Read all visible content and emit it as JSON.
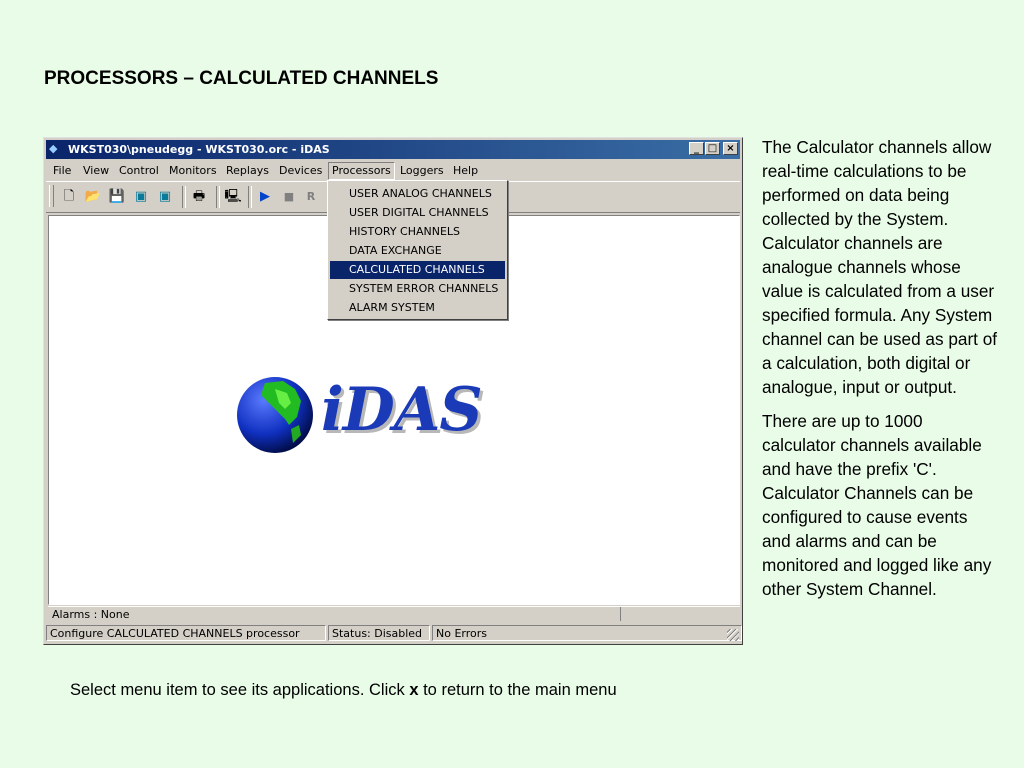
{
  "slide": {
    "title": "PROCESSORS – CALCULATED CHANNELS",
    "description_paragraphs": [
      "The Calculator channels allow real-time calculations to be performed on data being collected by the System. Calculator channels are analogue channels whose value is calculated from a user specified formula. Any System channel can be used as part of a calculation, both digital or analogue, input or output.",
      "There are up to 1000 calculator channels available and have the prefix 'C'.  Calculator Channels can be configured to cause events and alarms and can be monitored and logged like any other System Channel."
    ],
    "caption_before": "Select menu item to see its applications. Click ",
    "caption_key": "x",
    "caption_after": " to return to the main menu"
  },
  "window": {
    "title": "WKST030\\pneudegg - WKST030.orc - iDAS",
    "caption_buttons": {
      "minimize": "_",
      "maximize": "□",
      "close": "×"
    },
    "menu": [
      "File",
      "View",
      "Control",
      "Monitors",
      "Replays",
      "Devices",
      "Processors",
      "Loggers",
      "Help"
    ],
    "open_menu": "Processors",
    "dropdown_items": [
      "USER ANALOG CHANNELS",
      "USER DIGITAL CHANNELS",
      "HISTORY CHANNELS",
      "DATA EXCHANGE",
      "CALCULATED CHANNELS",
      "SYSTEM ERROR CHANNELS",
      "ALARM SYSTEM"
    ],
    "selected_dropdown_item": "CALCULATED CHANNELS",
    "toolbar_icons": [
      "new-file-icon",
      "open-folder-icon",
      "save-icon",
      "monitor-add-icon",
      "monitor-edit-icon",
      "print-icon",
      "computer-icon",
      "play-icon",
      "stop-icon",
      "replay-icon"
    ],
    "logo_text": "iDAS",
    "alarms_label": "Alarms :  None",
    "status_panels": [
      "Configure CALCULATED CHANNELS processor",
      "Status: Disabled",
      "No Errors"
    ]
  },
  "colors": {
    "background": "#e8fce8",
    "titlebar": "#0a246a",
    "menu_highlight": "#0a246a",
    "logo_blue": "#1a3ab8"
  }
}
